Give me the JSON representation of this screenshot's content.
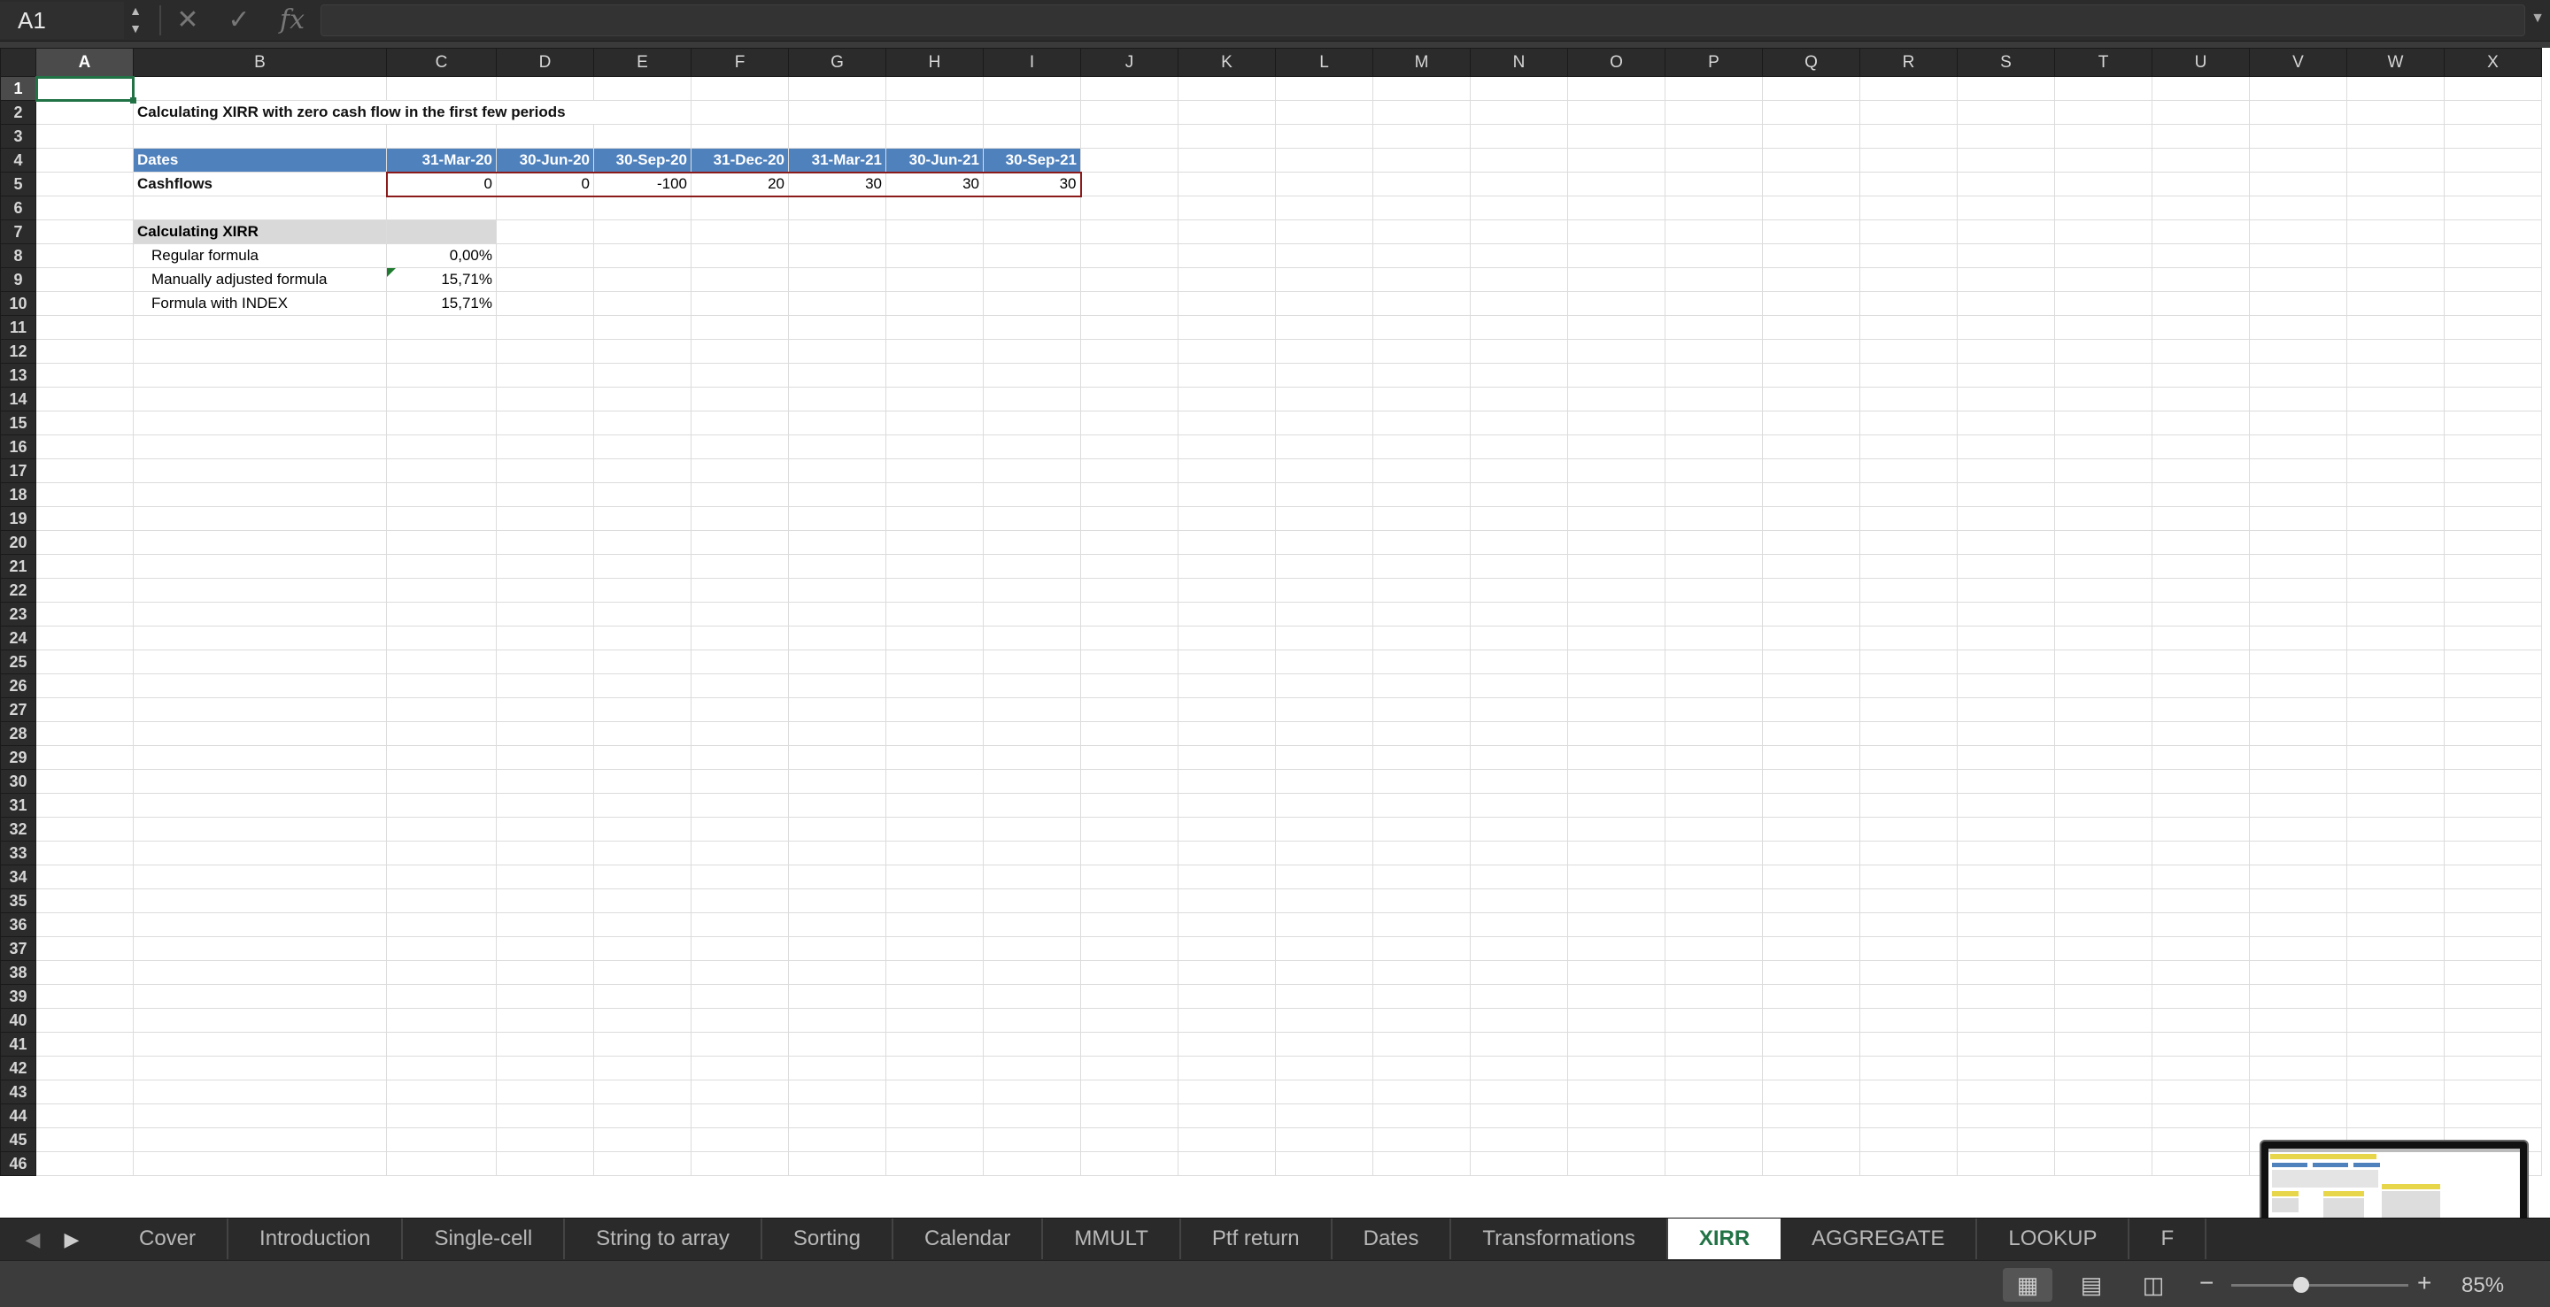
{
  "formula_bar": {
    "name_box": "A1",
    "cancel_icon": "close-icon",
    "confirm_icon": "checkmark-icon",
    "fx_label": "fx",
    "formula": ""
  },
  "columns": [
    "A",
    "B",
    "C",
    "D",
    "E",
    "F",
    "G",
    "H",
    "I",
    "J",
    "K",
    "L",
    "M",
    "N",
    "O",
    "P",
    "Q",
    "R",
    "S",
    "T",
    "U",
    "V",
    "W",
    "X"
  ],
  "row_count": 46,
  "sheet": {
    "title": "Calculating XIRR with zero cash flow in the first few periods",
    "dates_label": "Dates",
    "dates": [
      "31-Mar-20",
      "30-Jun-20",
      "30-Sep-20",
      "31-Dec-20",
      "31-Mar-21",
      "30-Jun-21",
      "30-Sep-21"
    ],
    "cashflows_label": "Cashflows",
    "cashflows": [
      "0",
      "0",
      "-100",
      "20",
      "30",
      "30",
      "30"
    ],
    "section_title": "Calculating XIRR",
    "results": [
      {
        "label": "Regular formula",
        "value": "0,00%"
      },
      {
        "label": "Manually adjusted formula",
        "value": "15,71%"
      },
      {
        "label": "Formula with INDEX",
        "value": "15,71%"
      }
    ]
  },
  "tabs": [
    "Cover",
    "Introduction",
    "Single-cell",
    "String to array",
    "Sorting",
    "Calendar",
    "MMULT",
    "Ptf return",
    "Dates",
    "Transformations",
    "XIRR",
    "AGGREGATE",
    "LOOKUP",
    "F"
  ],
  "active_tab": "XIRR",
  "status": {
    "zoom": "85%"
  },
  "colors": {
    "accent": "#217346",
    "table_header": "#4f81bd",
    "cashflow_border": "#8b1a1a"
  }
}
